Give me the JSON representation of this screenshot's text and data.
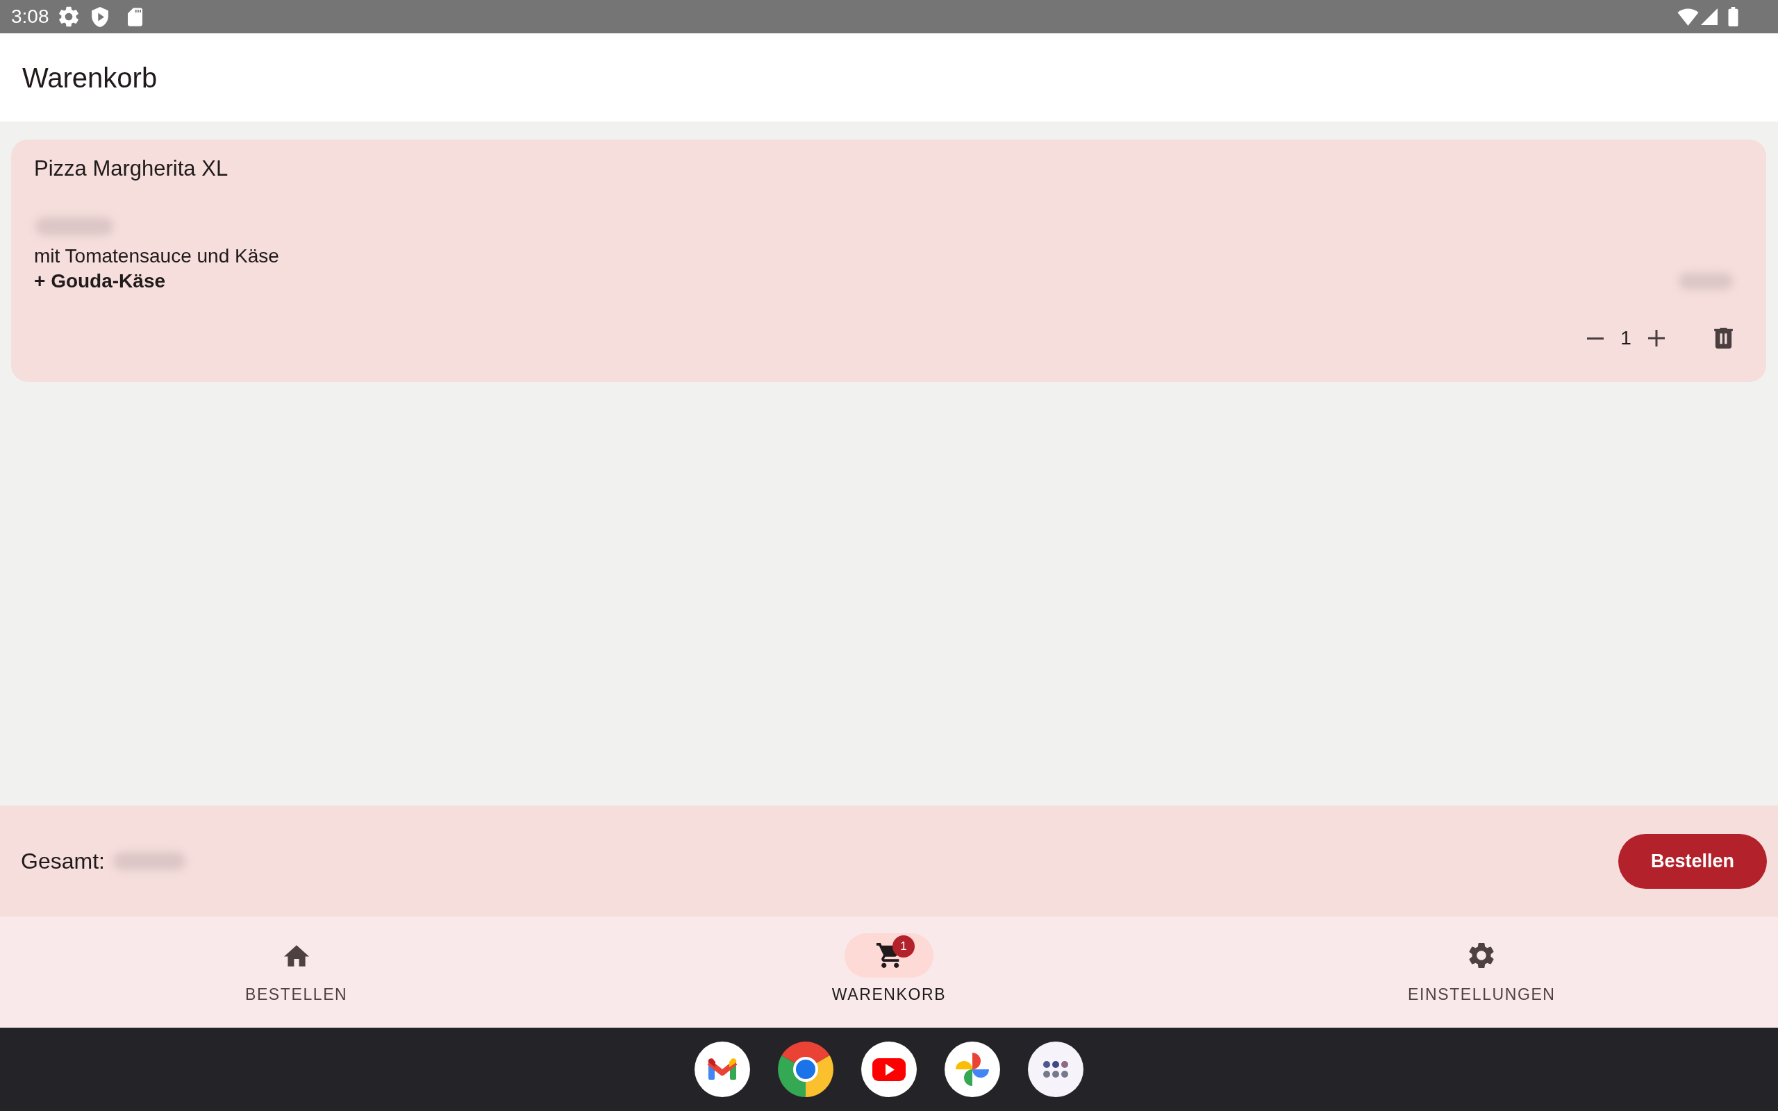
{
  "status_bar": {
    "time": "3:08"
  },
  "app_bar": {
    "title": "Warenkorb"
  },
  "cart_items": [
    {
      "name": "Pizza Margherita XL",
      "description": "mit Tomatensauce und Käse",
      "extras": [
        "+ Gouda-Käse"
      ],
      "quantity": "1"
    }
  ],
  "summary": {
    "label": "Gesamt:",
    "order_button": "Bestellen"
  },
  "bottom_nav": [
    {
      "kind": "home",
      "label": "BESTELLEN",
      "selected": false
    },
    {
      "kind": "cart",
      "label": "WARENKORB",
      "selected": true,
      "badge": "1"
    },
    {
      "kind": "settings",
      "label": "EINSTELLUNGEN",
      "selected": false
    }
  ]
}
